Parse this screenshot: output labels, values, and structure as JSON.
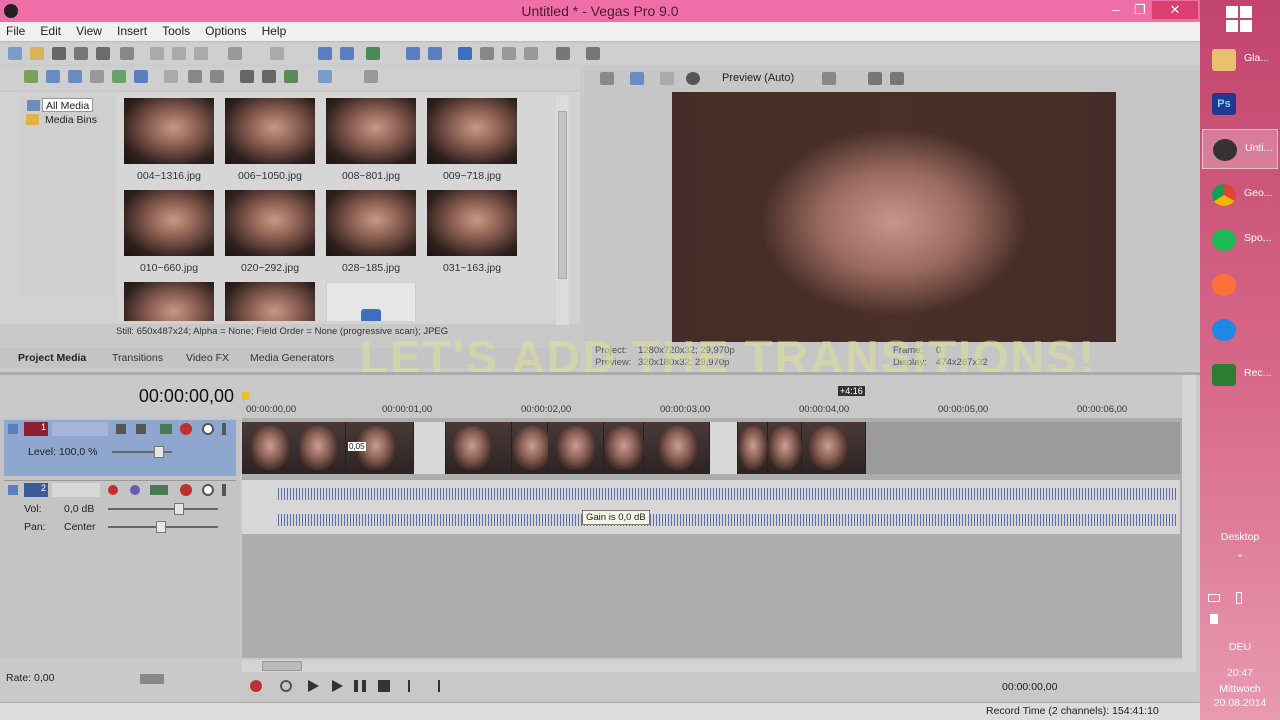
{
  "window": {
    "title": "Untitled * - Vegas Pro 9.0",
    "minimize": "‒",
    "restore": "❐",
    "close": "✕"
  },
  "menu": [
    "File",
    "Edit",
    "View",
    "Insert",
    "Tools",
    "Options",
    "Help"
  ],
  "media_tree": {
    "items": [
      "All Media",
      "Media Bins"
    ]
  },
  "media_files": [
    "004~1316.jpg",
    "006~1050.jpg",
    "008~801.jpg",
    "009~718.jpg",
    "010~660.jpg",
    "020~292.jpg",
    "028~185.jpg",
    "031~163.jpg"
  ],
  "media_info": "Still: 650x487x24; Alpha = None; Field Order = None (progressive scan); JPEG",
  "panel_tabs": [
    "Project Media",
    "Transitions",
    "Video FX",
    "Media Generators"
  ],
  "preview": {
    "mode": "Preview (Auto)",
    "project_label": "Project:",
    "project_value": "1280x720x32; 29,970p",
    "preview_label": "Preview:",
    "preview_value": "320x180x32; 29,970p",
    "frame_label": "Frame:",
    "frame_value": "0",
    "display_label": "Display:",
    "display_value": "474x267x32"
  },
  "overlay_caption": "LET'S ADD THE TRANSITIONS!",
  "timeline": {
    "timecode": "00:00:00,00",
    "ruler_ticks": [
      "00:00:00,00",
      "00:00:01,00",
      "00:00:02,00",
      "00:00:03,00",
      "00:00:04,00",
      "00:00:05,00",
      "00:00:06,00"
    ],
    "end_marker": "+4:16",
    "crossfade_label": "0,05"
  },
  "tracks": {
    "video": {
      "number": "1",
      "level_label": "Level: 100,0 %"
    },
    "audio": {
      "number": "2",
      "vol_label": "Vol:",
      "vol_value": "0,0 dB",
      "pan_label": "Pan:",
      "pan_value": "Center"
    }
  },
  "tooltip": "Gain is 0,0 dB",
  "rate": "Rate: 0,00",
  "transport_timecode": "00:00:00,00",
  "status": "Record Time (2 channels): 154:41:10",
  "taskbar": {
    "items": [
      {
        "label": "Gla...",
        "color": "#e8c070"
      },
      {
        "label": "",
        "color": "#1e3a8a",
        "text": "Ps"
      },
      {
        "label": "Unti...",
        "color": "#333333"
      },
      {
        "label": "Geo...",
        "color": "#e8e8e8"
      },
      {
        "label": "Spo...",
        "color": "#1db954"
      },
      {
        "label": "",
        "color": "#ff7139"
      },
      {
        "label": "",
        "color": "#1e88e5"
      },
      {
        "label": "Rec...",
        "color": "#2e7d32"
      }
    ],
    "desktop": "Desktop",
    "lang": "DEU",
    "time": "20:47",
    "day": "Mittwoch",
    "date": "20.08.2014"
  }
}
